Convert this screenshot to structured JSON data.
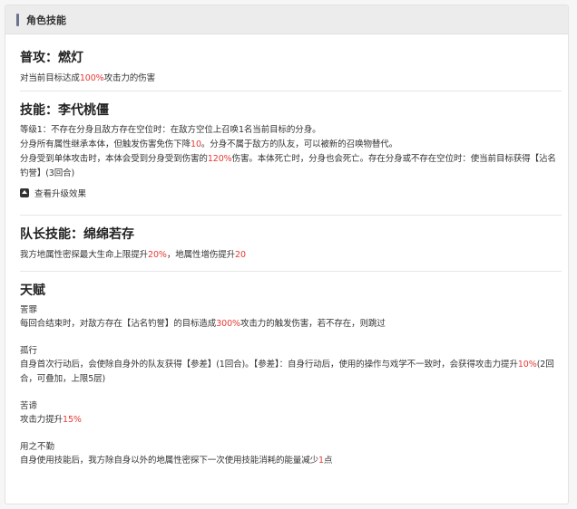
{
  "header": {
    "title": "角色技能"
  },
  "normal_attack": {
    "title": "普攻：燃灯",
    "desc": [
      "对当前目标达成",
      "100%",
      "攻击力的伤害"
    ]
  },
  "skill": {
    "title": "技能：李代桃僵",
    "lines": [
      [
        "等级1：不存在分身且敌方存在空位时：在敌方空位上召唤1名当前目标的分身。"
      ],
      [
        "分身所有属性继承本体，但触发伤害免伤下降",
        "10",
        "。分身不属于敌方的队友，可以被新的召唤物替代。"
      ],
      [
        "分身受到单体攻击时，本体会受到分身受到伤害的",
        "120%",
        "伤害。本体死亡时，分身也会死亡。存在分身或不存在空位时：使当前目标获得【沾名钓誉】(3回合)"
      ]
    ],
    "upgrade_toggle": "查看升级效果"
  },
  "leader_skill": {
    "title": "队长技能：绵绵若存",
    "desc": [
      "我方地属性密探最大生命上限提升",
      "20%",
      "，地属性增伤提升",
      "20"
    ]
  },
  "talents": {
    "title": "天赋",
    "items": [
      {
        "name": "詈罪",
        "desc": [
          "每回合结束时，对敌方存在【沾名钓誉】的目标造成",
          "300%",
          "攻击力的触发伤害，若不存在，则跳过"
        ]
      },
      {
        "name": "孤行",
        "desc": [
          "自身首次行动后，会使除自身外的队友获得【参差】(1回合)。【参差】：自身行动后，使用的操作与戏学不一致时，会获得攻击力提升",
          "10%",
          "(2回合，可叠加，上限5层)"
        ]
      },
      {
        "name": "苦谛",
        "desc": [
          "攻击力提升",
          "15%",
          ""
        ]
      },
      {
        "name": "用之不勤",
        "desc": [
          "自身使用技能后，我方除自身以外的地属性密探下一次使用技能消耗的能量减少",
          "1",
          "点"
        ]
      }
    ]
  },
  "colors": {
    "highlight": "#e53935",
    "header_bg": "#ececec",
    "accent_bar": "#6b7390"
  }
}
